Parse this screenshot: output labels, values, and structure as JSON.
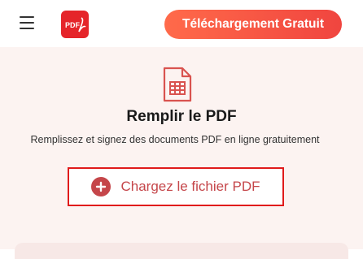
{
  "header": {
    "menu_icon": "hamburger-menu-icon",
    "logo_icon": "pdf-logo-icon",
    "logo_text": "PDF",
    "download_label": "Téléchargement Gratuit"
  },
  "main": {
    "tool_icon": "file-table-icon",
    "title": "Remplir le PDF",
    "subtitle": "Remplissez et signez des documents PDF en ligne gratuitement",
    "upload_icon": "plus-circle-icon",
    "upload_label": "Chargez le fichier PDF"
  },
  "colors": {
    "accent": "#e5252a",
    "button_gradient_start": "#ff6a4a",
    "button_gradient_end": "#f0453f",
    "upload_border": "#e01b1b",
    "upload_text": "#c5464a",
    "background": "#fcf3f1"
  }
}
